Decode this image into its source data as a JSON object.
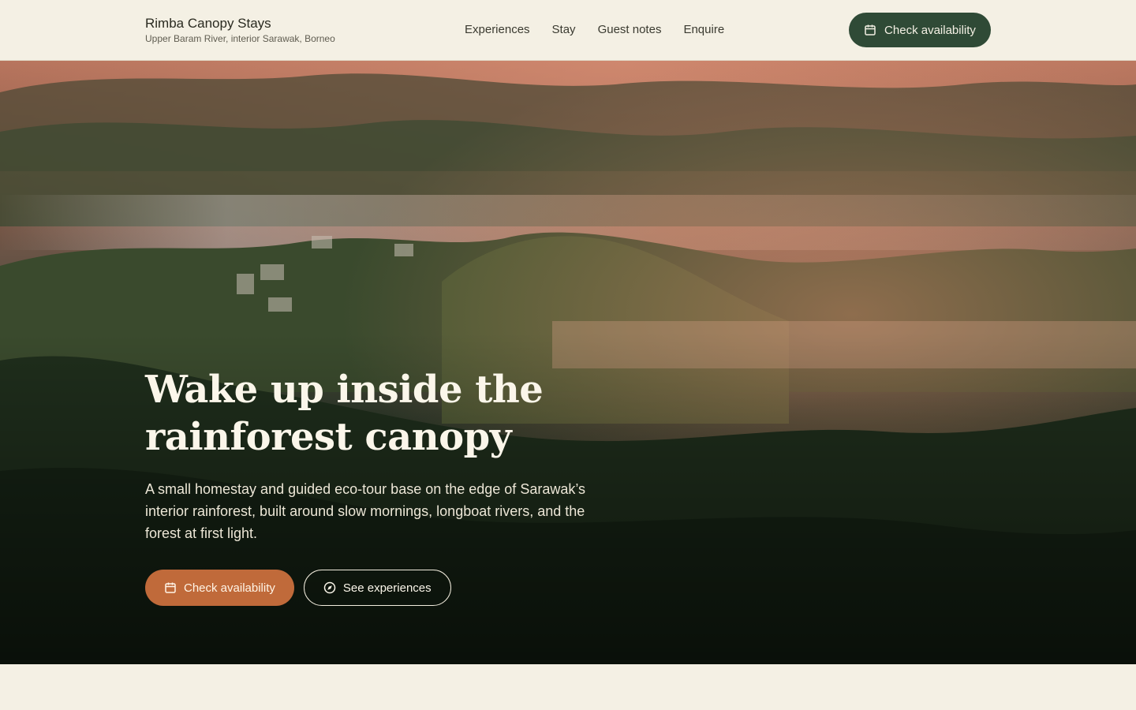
{
  "brand": {
    "name": "Rimba Canopy Stays",
    "location": "Upper Baram River, interior Sarawak, Borneo"
  },
  "nav": {
    "items": [
      {
        "label": "Experiences"
      },
      {
        "label": "Stay"
      },
      {
        "label": "Guest notes"
      },
      {
        "label": "Enquire"
      }
    ]
  },
  "header": {
    "cta_label": "Check availability",
    "cta_icon": "calendar-icon"
  },
  "hero": {
    "title": "Wake up inside the rainforest canopy",
    "text": "A small homestay and guided eco-tour base on the edge of Sarawak’s interior rainforest, built around slow mornings, longboat rivers, and the forest at first light.",
    "primary_label": "Check availability",
    "primary_icon": "calendar-icon",
    "secondary_label": "See experiences",
    "secondary_icon": "compass-icon"
  },
  "colors": {
    "background": "#f4f0e4",
    "forest_green": "#2f4a36",
    "accent_orange": "#c06a3a"
  }
}
